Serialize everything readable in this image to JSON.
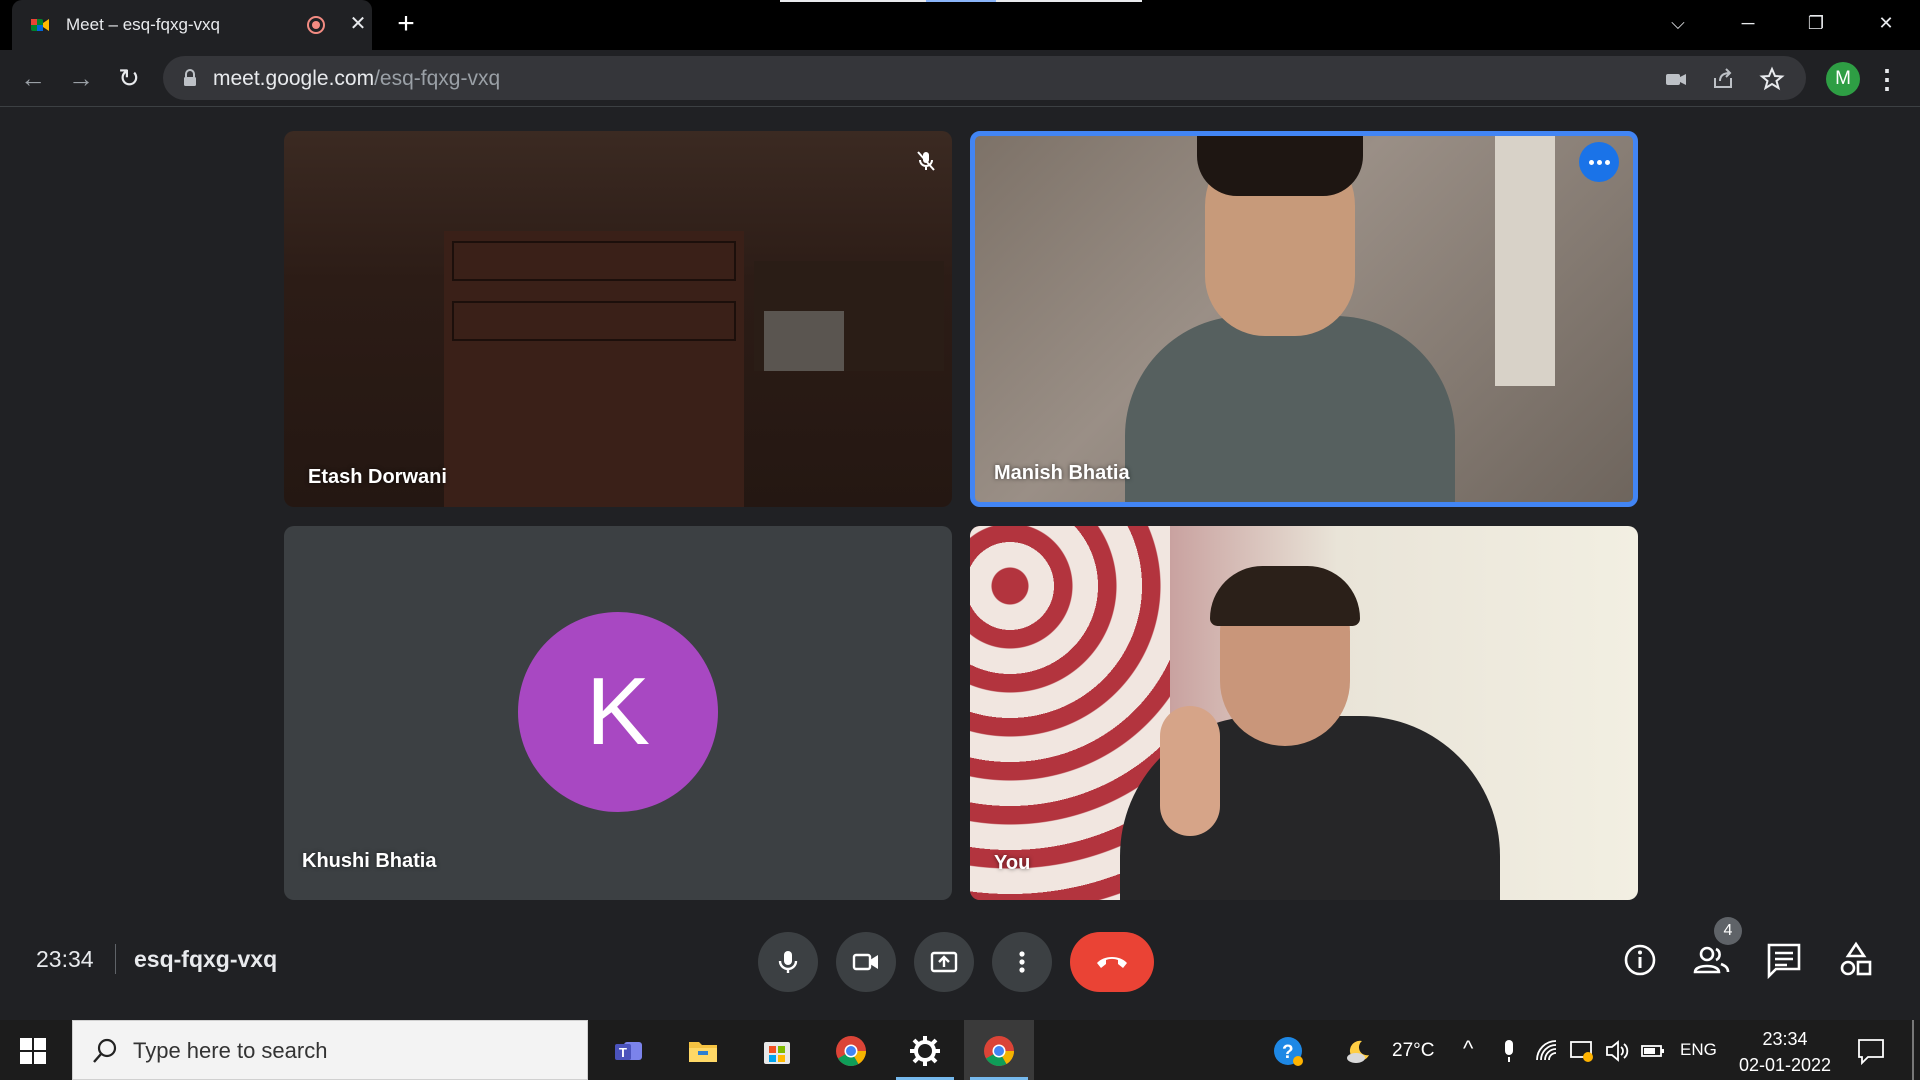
{
  "browser": {
    "tab_title": "Meet – esq-fqxg-vxq",
    "url_host": "meet.google.com",
    "url_path": "/esq-fqxg-vxq",
    "profile_initial": "M"
  },
  "meeting": {
    "time": "23:34",
    "code": "esq-fqxg-vxq",
    "participant_count": "4",
    "tiles": [
      {
        "name": "Etash Dorwani",
        "muted": true
      },
      {
        "name": "Manish Bhatia",
        "speaking": true
      },
      {
        "name": "Khushi Bhatia",
        "avatar_letter": "K"
      },
      {
        "name": "You"
      }
    ]
  },
  "taskbar": {
    "search_placeholder": "Type here to search",
    "temperature": "27°C",
    "language": "ENG",
    "time": "23:34",
    "date": "02-01-2022"
  },
  "colors": {
    "speaking_border": "#4285f4",
    "hangup": "#ea4335",
    "avatar_k": "#a848c2",
    "profile": "#2e9e44"
  }
}
